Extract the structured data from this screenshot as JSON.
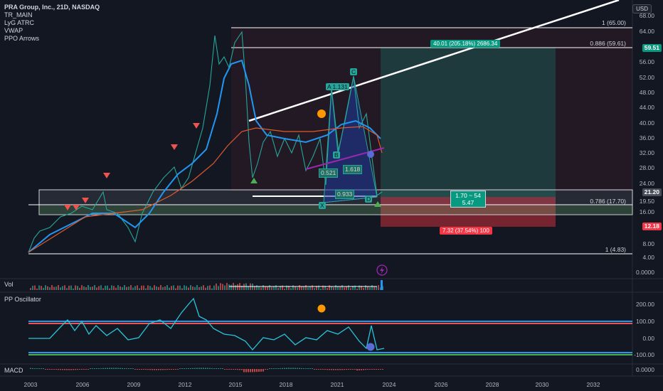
{
  "legend": {
    "title": "PRA Group, Inc., 21D, NASDAQ",
    "indicators": [
      "TR_MAIN",
      "LyG ATRC",
      "VWAP",
      "PPO Arrows"
    ]
  },
  "currency_button": "USD",
  "price_axis": {
    "labels": [
      "68.00",
      "64.00",
      "60.00",
      "56.00",
      "52.00",
      "48.00",
      "44.00",
      "40.00",
      "36.00",
      "32.00",
      "28.00",
      "24.00",
      "21.20",
      "19.50",
      "16.00",
      "12.00",
      "8.00",
      "4.00",
      "0.0000"
    ],
    "current_price": "21.20",
    "tag_top": "59.51",
    "tag_bottom": "12.18"
  },
  "fib_levels": {
    "l1_top": "1 (65.00)",
    "l0886": "0.886 (59.61)",
    "l0786": "0.786 (17.70)",
    "l1_bottom": "1 (4.83)"
  },
  "position_tool": {
    "profit": "40.01 (205.18%) 2686.34",
    "ratio_line1": "1.70 ~ 54",
    "ratio_line2": "5.47",
    "loss": "7.32 (37.54%) 100"
  },
  "harmonic": {
    "points": [
      "X",
      "A",
      "B",
      "C",
      "D"
    ],
    "a_label": "A 1.131",
    "ratio_b": "0.521",
    "ratio_c": "1.618",
    "ratio_d": "0.933"
  },
  "panes": {
    "vol": "Vol",
    "pp": "PP Oscillator",
    "macd": "MACD",
    "pp_axis": [
      "200.00",
      "100.00",
      "0.00",
      "-100.00"
    ],
    "macd_axis": "0.0000"
  },
  "time_axis": [
    "2003",
    "2006",
    "2009",
    "2012",
    "2015",
    "2018",
    "2021",
    "2024",
    "2026",
    "2028",
    "2030",
    "2032"
  ],
  "colors": {
    "background": "#131722",
    "up": "#26a69a",
    "down": "#ef5350",
    "atrc": "#2196f3",
    "vwap": "#e05a2c",
    "harmonic_fill": "#1e3a9f"
  }
}
